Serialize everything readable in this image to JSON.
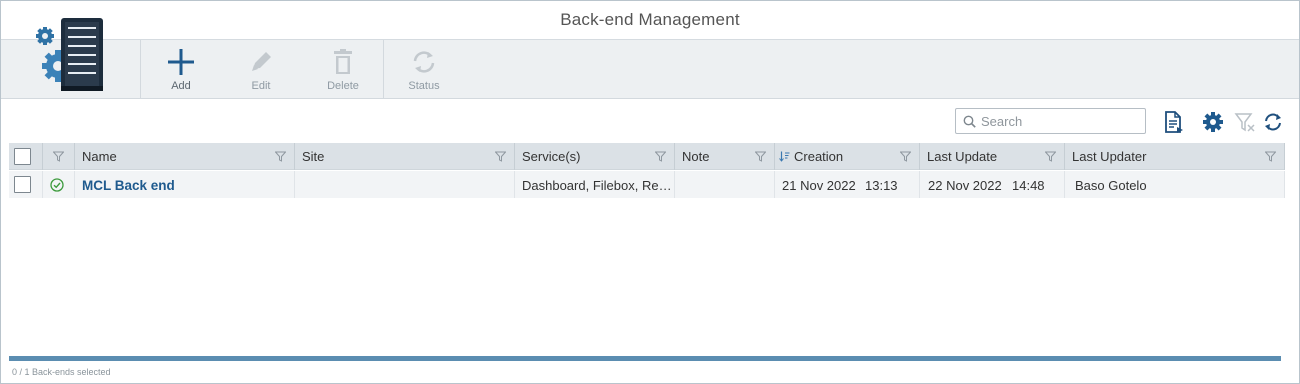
{
  "window": {
    "title": "Back-end Management"
  },
  "toolbar": {
    "add_label": "Add",
    "edit_label": "Edit",
    "delete_label": "Delete",
    "status_label": "Status"
  },
  "search": {
    "placeholder": "Search"
  },
  "grid": {
    "columns": [
      {
        "label": ""
      },
      {
        "label": ""
      },
      {
        "label": "Name"
      },
      {
        "label": "Site"
      },
      {
        "label": "Service(s)"
      },
      {
        "label": "Note"
      },
      {
        "label": "Creation"
      },
      {
        "label": "Last Update"
      },
      {
        "label": "Last Updater"
      }
    ],
    "rows": [
      {
        "status": "enabled",
        "name": "MCL Back end",
        "site": "",
        "services": "Dashboard, Filebox, Re…",
        "note": "",
        "creation_date": "21 Nov 2022",
        "creation_time": "13:13",
        "last_update_date": "22 Nov 2022",
        "last_update_time": "14:48",
        "last_updater": "Baso Gotelo"
      }
    ]
  },
  "footer": {
    "selection_text": "0 / 1 Back-ends selected"
  },
  "colors": {
    "accent": "#1f5a8e",
    "toolbar_bg": "#edf0f2",
    "header_bg": "#dbe1e6",
    "status_ok": "#3c9a3c",
    "scrollbar": "#5b8db1"
  },
  "icons": {
    "logo": "server-gears-icon",
    "add": "plus-icon",
    "edit": "pencil-icon",
    "delete": "trash-icon",
    "status": "refresh-status-icon",
    "export": "export-document-icon",
    "settings": "gear-icon",
    "clear_filter": "clear-filter-icon",
    "refresh": "refresh-icon"
  }
}
